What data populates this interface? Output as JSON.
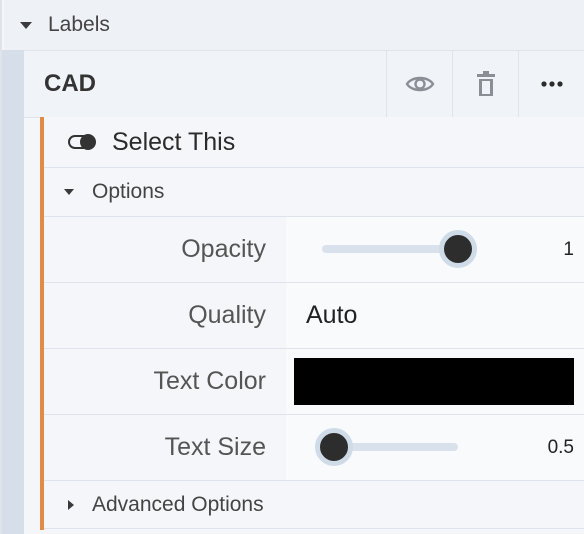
{
  "labels_section": {
    "title": "Labels"
  },
  "layer": {
    "name": "CAD",
    "actions": [
      {
        "name": "eye-icon",
        "label": ""
      },
      {
        "name": "trash-icon",
        "label": ""
      },
      {
        "name": "more-icon",
        "label": ""
      }
    ]
  },
  "select_toggle": {
    "label": "Select This",
    "on": true
  },
  "options_section": {
    "title": "Options"
  },
  "properties": {
    "opacity": {
      "label": "Opacity",
      "value": "1",
      "fraction": 1.0
    },
    "quality": {
      "label": "Quality",
      "value": "Auto"
    },
    "text_color": {
      "label": "Text Color",
      "color": "#000000"
    },
    "text_size": {
      "label": "Text Size",
      "value": "0.5",
      "fraction": 0.0
    }
  },
  "advanced_section": {
    "title": "Advanced Options"
  },
  "colors": {
    "accent": "#e28b47",
    "rail": "#d6dee9"
  }
}
